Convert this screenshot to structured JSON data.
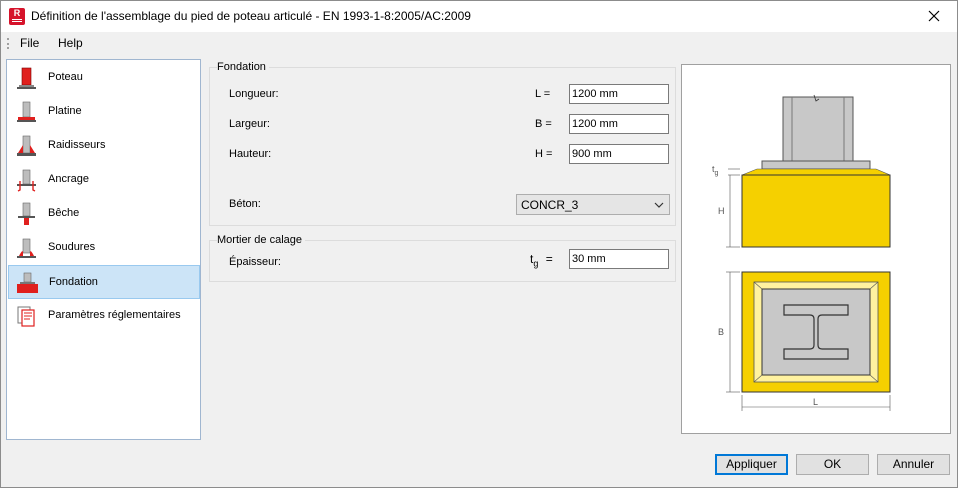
{
  "window": {
    "title": "Définition de l'assemblage du pied de poteau articulé - EN 1993-1-8:2005/AC:2009",
    "app_icon_letter": "R"
  },
  "menu": {
    "file": "File",
    "help": "Help"
  },
  "sidebar": {
    "items": [
      {
        "label": "Poteau",
        "icon": "column-icon",
        "selected": false
      },
      {
        "label": "Platine",
        "icon": "base-plate-icon",
        "selected": false
      },
      {
        "label": "Raidisseurs",
        "icon": "stiffeners-icon",
        "selected": false
      },
      {
        "label": "Ancrage",
        "icon": "anchorage-icon",
        "selected": false
      },
      {
        "label": "Bêche",
        "icon": "shear-key-icon",
        "selected": false
      },
      {
        "label": "Soudures",
        "icon": "welds-icon",
        "selected": false
      },
      {
        "label": "Fondation",
        "icon": "foundation-icon",
        "selected": true
      },
      {
        "label": "Paramètres réglementaires",
        "icon": "code-parameters-icon",
        "selected": false
      }
    ]
  },
  "fondation": {
    "title": "Fondation",
    "longueur": {
      "label": "Longueur:",
      "symbol": "L =",
      "value": "1200 mm"
    },
    "largeur": {
      "label": "Largeur:",
      "symbol": "B =",
      "value": "1200 mm"
    },
    "hauteur": {
      "label": "Hauteur:",
      "symbol": "H =",
      "value": "900 mm"
    },
    "beton": {
      "label": "Béton:",
      "value": "CONCR_3"
    }
  },
  "mortier": {
    "title": "Mortier de calage",
    "epaisseur": {
      "label": "Épaisseur:",
      "symbol": "t",
      "symbol_sub": "g",
      "symbol_eq": "=",
      "value": "30 mm"
    }
  },
  "preview": {
    "tg_label": "t",
    "tg_sub": "g",
    "h_label": "H",
    "b_label": "B",
    "l_label": "L"
  },
  "buttons": {
    "apply": "Appliquer",
    "ok": "OK",
    "cancel": "Annuler"
  },
  "colors": {
    "accent": "#0078d7",
    "selected_bg": "#cce4f7",
    "concrete_yellow": "#f5d000",
    "steel_gray": "#c8c8c8",
    "icon_red": "#e0201e"
  }
}
